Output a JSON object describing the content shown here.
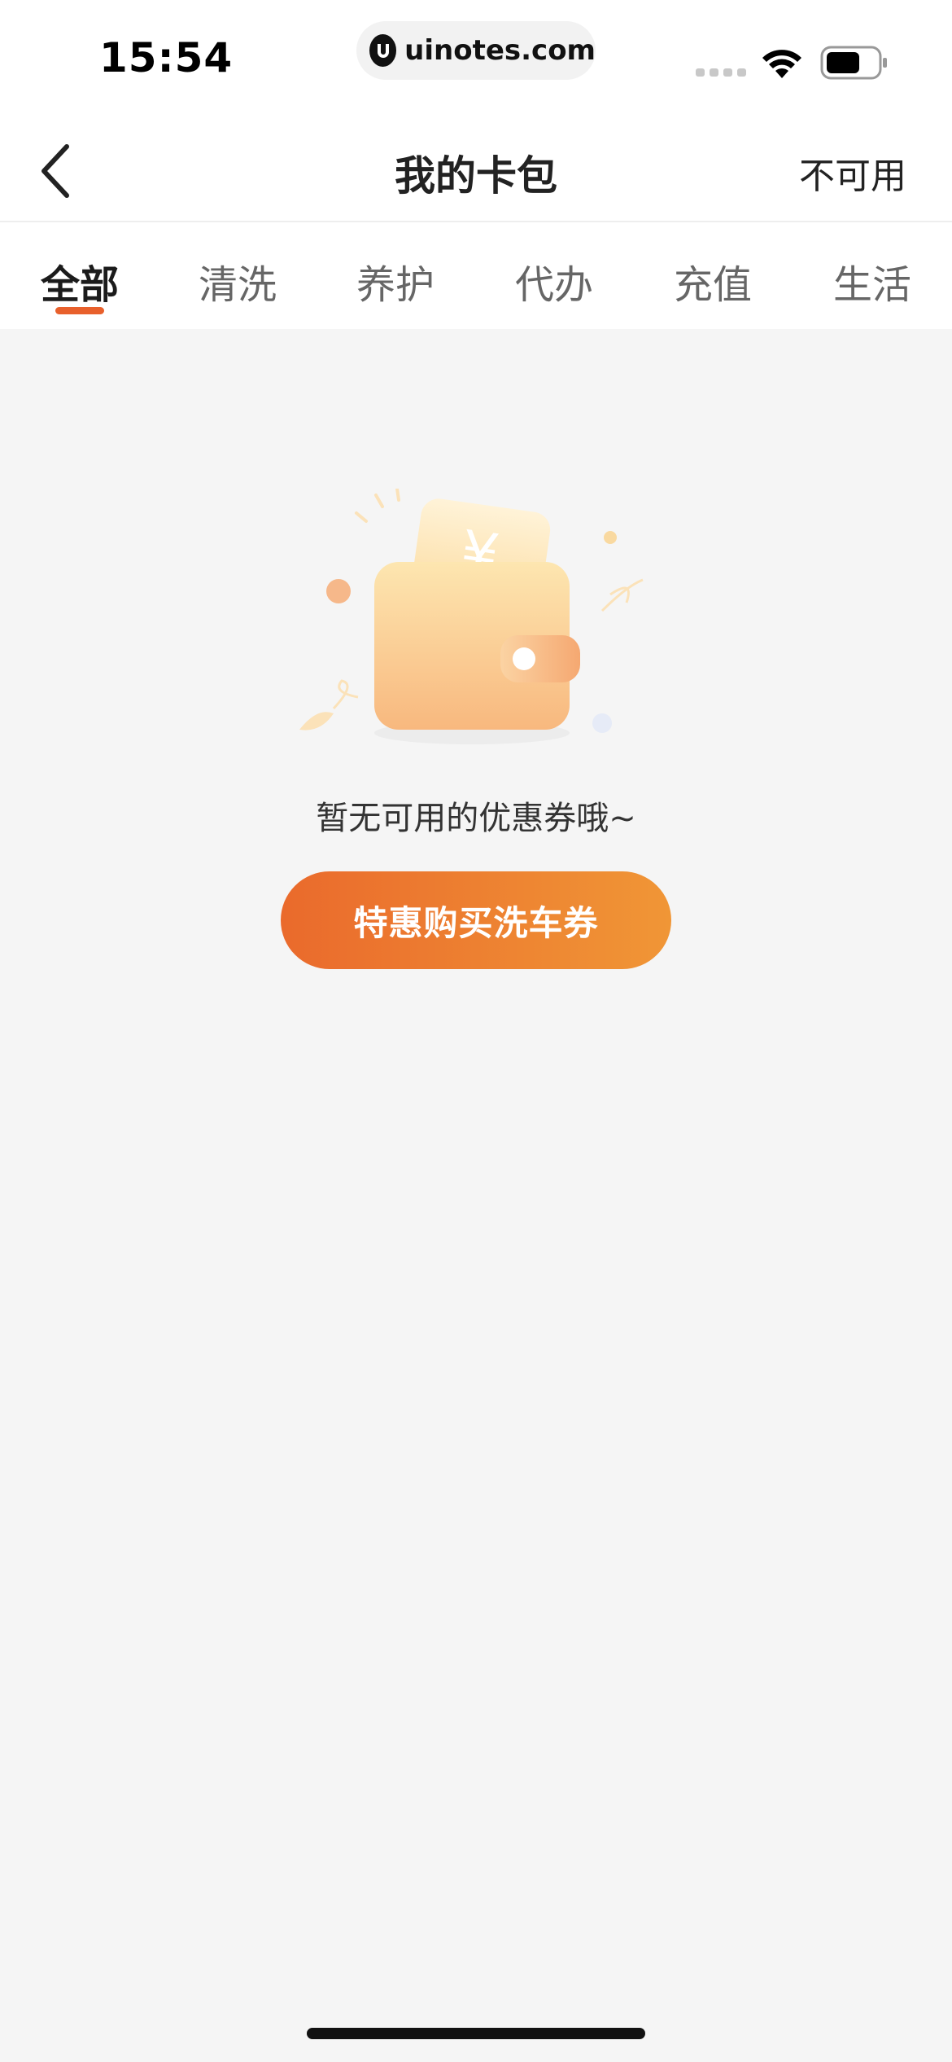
{
  "status_bar": {
    "time": "15:54",
    "url": "uinotes.com",
    "icons": [
      "signal-icon",
      "wifi-icon",
      "battery-icon"
    ]
  },
  "nav": {
    "back_icon": "chevron-left-icon",
    "title": "我的卡包",
    "right_action": "不可用"
  },
  "tabs": [
    {
      "label": "全部",
      "active": true
    },
    {
      "label": "清洗",
      "active": false
    },
    {
      "label": "养护",
      "active": false
    },
    {
      "label": "代办",
      "active": false
    },
    {
      "label": "充值",
      "active": false
    },
    {
      "label": "生活",
      "active": false
    }
  ],
  "empty_state": {
    "illustration_icon": "wallet-coupon-icon",
    "message": "暂无可用的优惠券哦~",
    "button_label": "特惠购买洗车券"
  },
  "colors": {
    "accent": "#e8602c",
    "button_start": "#ea6a2c",
    "button_end": "#f09636",
    "background": "#f5f5f5"
  }
}
